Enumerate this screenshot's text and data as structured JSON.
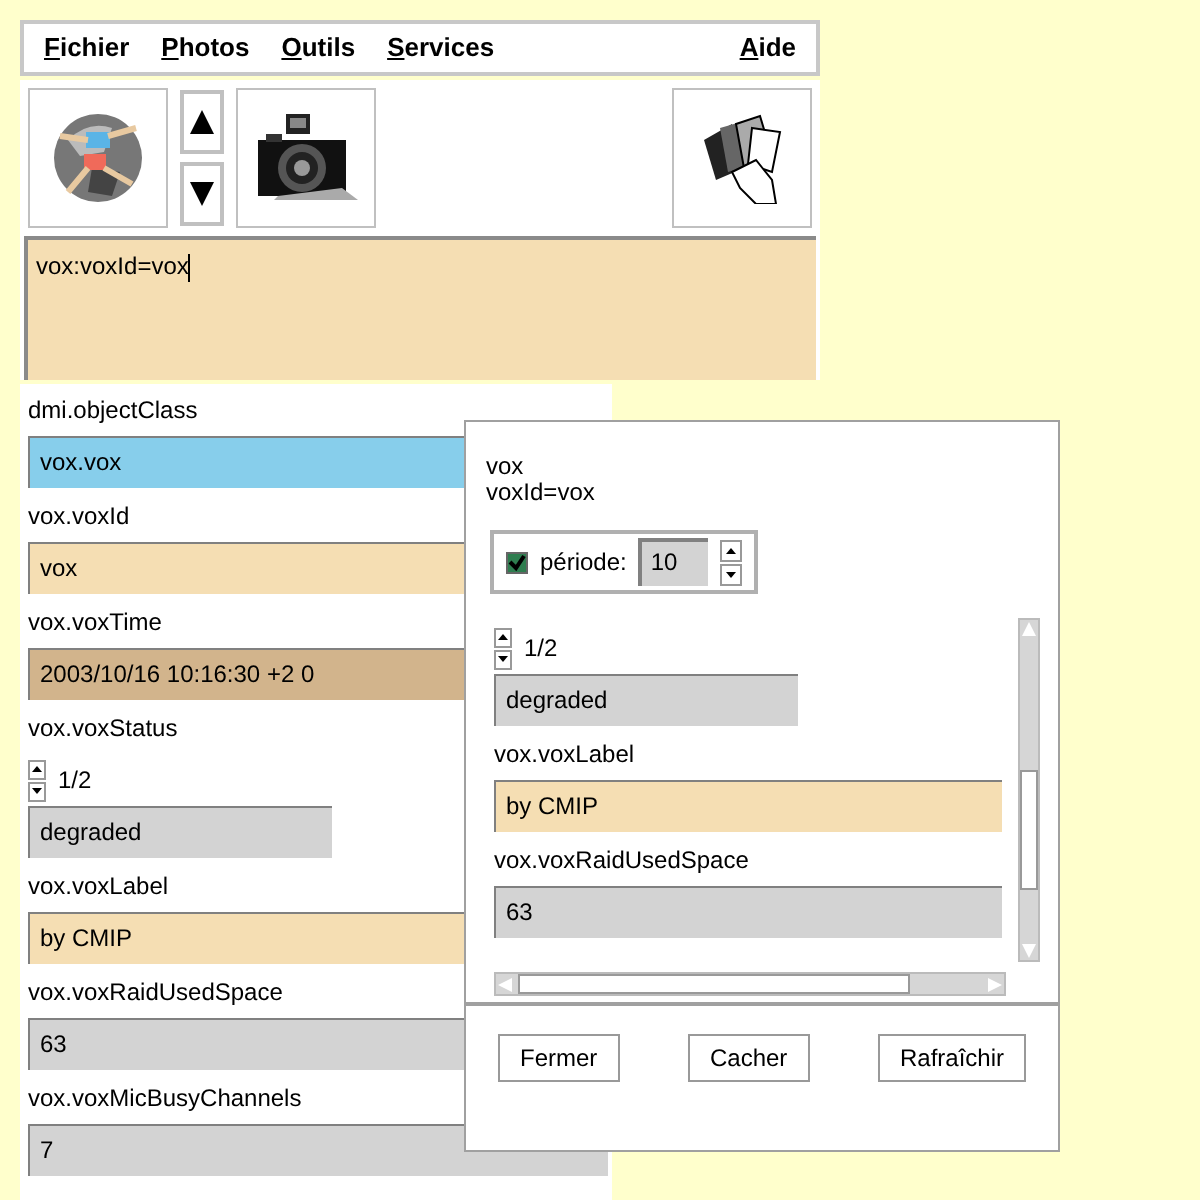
{
  "menu": [
    {
      "label": "Fichier"
    },
    {
      "label": "Photos"
    },
    {
      "label": "Outils"
    },
    {
      "label": "Services"
    },
    {
      "label": "Aide"
    }
  ],
  "query": {
    "value": "vox:voxId=vox"
  },
  "fields": [
    {
      "kind": "label",
      "text": "dmi.objectClass"
    },
    {
      "kind": "value",
      "text": "vox.vox",
      "color": "#87ceeb"
    },
    {
      "kind": "label",
      "text": "vox.voxId"
    },
    {
      "kind": "value",
      "text": "vox",
      "color": "#f5deb3"
    },
    {
      "kind": "label",
      "text": "vox.voxTime"
    },
    {
      "kind": "value",
      "text": "2003/10/16 10:16:30 +2 0",
      "color": "#d2b48c"
    },
    {
      "kind": "label",
      "text": "vox.voxStatus"
    },
    {
      "kind": "pager",
      "text": "1/2"
    },
    {
      "kind": "enum",
      "text": "degraded",
      "color": "#d3d3d3"
    },
    {
      "kind": "label",
      "text": "vox.voxLabel"
    },
    {
      "kind": "value",
      "text": "by CMIP",
      "color": "#f5deb3"
    },
    {
      "kind": "label",
      "text": "vox.voxRaidUsedSpace"
    },
    {
      "kind": "value",
      "text": "63",
      "color": "#d3d3d3"
    },
    {
      "kind": "label",
      "text": "vox.voxMicBusyChannels"
    },
    {
      "kind": "value",
      "text": "7",
      "color": "#d3d3d3"
    }
  ],
  "dialog": {
    "header": [
      "vox",
      "voxId=vox"
    ],
    "period": {
      "checked": true,
      "label": "période:",
      "value": "10"
    },
    "fields": [
      {
        "kind": "pager",
        "text": "1/2"
      },
      {
        "kind": "enum",
        "text": "degraded",
        "color": "#d3d3d3"
      },
      {
        "kind": "label",
        "text": "vox.voxLabel"
      },
      {
        "kind": "value",
        "text": "by CMIP",
        "color": "#f5deb3"
      },
      {
        "kind": "label",
        "text": "vox.voxRaidUsedSpace"
      },
      {
        "kind": "value",
        "text": "63",
        "color": "#d3d3d3"
      }
    ],
    "buttons": [
      "Fermer",
      "Cacher",
      "Rafraîchir"
    ]
  }
}
